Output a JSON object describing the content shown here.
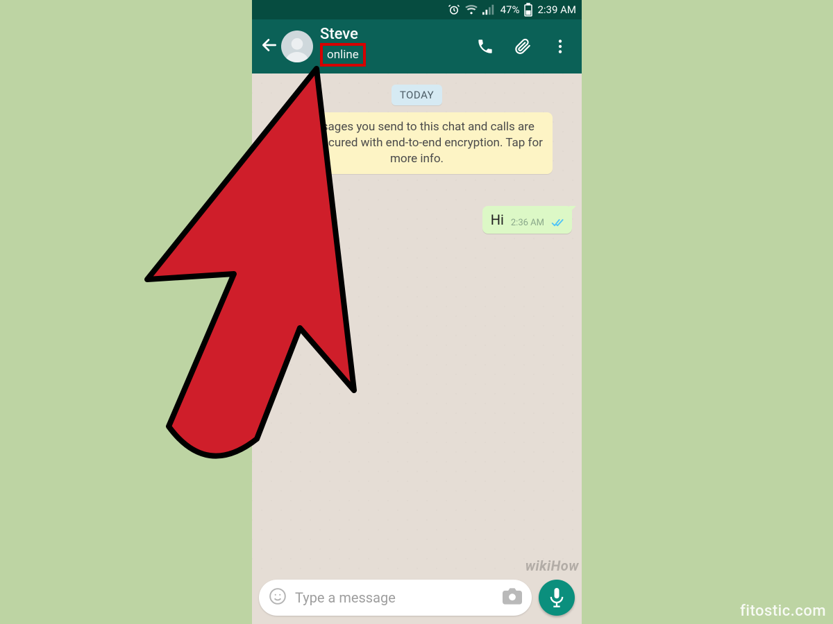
{
  "statusbar": {
    "battery_pct": "47%",
    "time": "2:39 AM"
  },
  "header": {
    "contact_name": "Steve",
    "status": "online"
  },
  "chat": {
    "date_chip": "TODAY",
    "encryption_banner": "Messages you send to this chat and calls are now secured with end-to-end encryption. Tap for more info.",
    "messages": [
      {
        "text": "Hi",
        "time": "2:36 AM",
        "direction": "out",
        "ticks": "read"
      }
    ]
  },
  "composer": {
    "placeholder": "Type a message"
  },
  "watermarks": {
    "site": "fitostic.com",
    "wikihow": "wikiHow"
  },
  "annotation": {
    "highlight_target": "status-line",
    "pointer_target": "status-line"
  }
}
